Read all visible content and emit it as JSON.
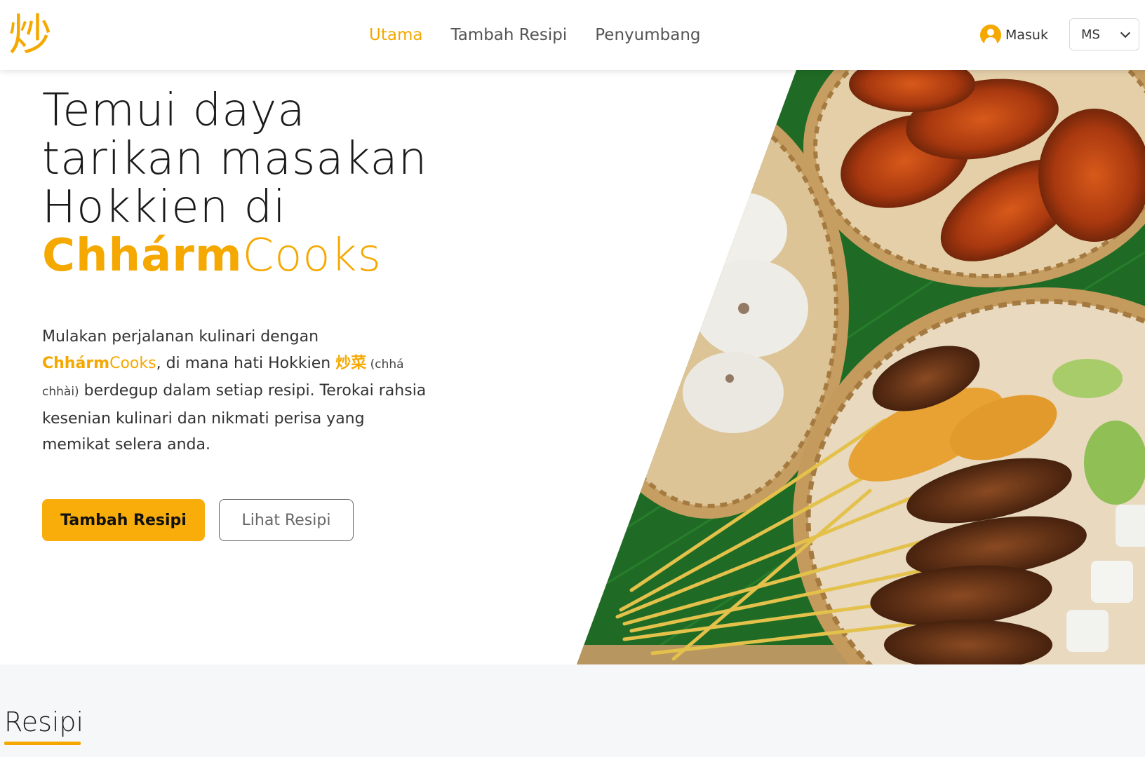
{
  "header": {
    "logo_glyph": "炒",
    "nav": [
      {
        "label": "Utama",
        "active": true
      },
      {
        "label": "Tambah Resipi",
        "active": false
      },
      {
        "label": "Penyumbang",
        "active": false
      }
    ],
    "login_label": "Masuk",
    "language": "MS"
  },
  "hero": {
    "title_lines": [
      "Temui daya",
      "tarikan masakan",
      "Hokkien di"
    ],
    "brand_bold": "Chhárm",
    "brand_light": "Cooks",
    "desc_part1": "Mulakan perjalanan kulinari dengan ",
    "desc_part2": ", di mana hati Hokkien ",
    "desc_hanzi": "炒菜",
    "desc_roman": " (chhá chhài)",
    "desc_part3": " berdegup dalam setiap resipi. Terokai rahsia kesenian kulinari dan nikmati perisa yang memikat selera anda.",
    "primary_button": "Tambah Resipi",
    "secondary_button": "Lihat Resipi",
    "image_subject": "satay-food-platter"
  },
  "recipes": {
    "title": "Resipi"
  },
  "colors": {
    "accent": "#f5a800",
    "button": "#f8ad0a",
    "section_bg": "#f6f7f9",
    "leaf_green": "#1f6b25"
  }
}
